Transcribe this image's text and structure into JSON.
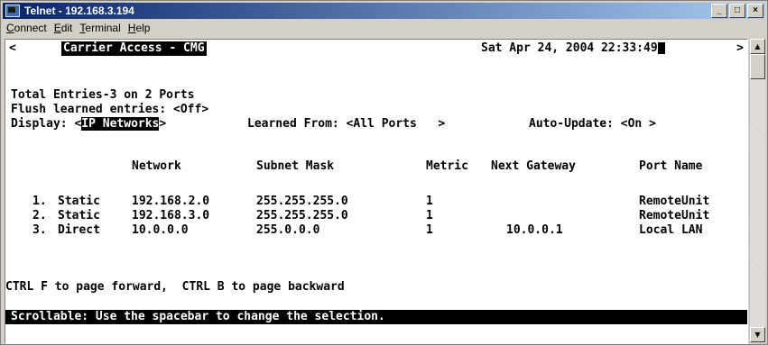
{
  "window": {
    "title": "Telnet - 192.168.3.194",
    "minimize_label": "_",
    "maximize_label": "□",
    "close_label": "×"
  },
  "menu": [
    "Connect",
    "Edit",
    "Terminal",
    "Help"
  ],
  "terminal": {
    "scroll_left": "<",
    "scroll_right": ">",
    "banner": "Carrier Access - CMG",
    "datetime": "Sat Apr 24, 2004 22:33:49",
    "summary": "Total Entries-3 on 2 Ports",
    "flush_label": "Flush learned entries: <Off>",
    "display_label": "Display: <",
    "display_value": "IP Networks",
    "display_close": ">",
    "learned_from": "Learned From: <All Ports   >",
    "auto_update": "Auto-Update: <On >",
    "columns": {
      "network": "Network",
      "subnet": "Subnet Mask",
      "metric": "Metric",
      "gateway": "Next Gateway",
      "port": "Port Name"
    },
    "rows": [
      {
        "index": "1.",
        "type": "Static",
        "network": "192.168.2.0",
        "subnet": "255.255.255.0",
        "metric": "1",
        "gateway": "",
        "port": "RemoteUnit"
      },
      {
        "index": "2.",
        "type": "Static",
        "network": "192.168.3.0",
        "subnet": "255.255.255.0",
        "metric": "1",
        "gateway": "",
        "port": "RemoteUnit"
      },
      {
        "index": "3.",
        "type": "Direct",
        "network": "10.0.0.0",
        "subnet": "255.0.0.0",
        "metric": "1",
        "gateway": "10.0.0.1",
        "port": "Local LAN"
      }
    ],
    "hint": "CTRL F to page forward,  CTRL B to page backward",
    "status": "Scrollable: Use the spacebar to change the selection."
  },
  "scrollbar": {
    "up_arrow": "▲",
    "down_arrow": "▼"
  }
}
